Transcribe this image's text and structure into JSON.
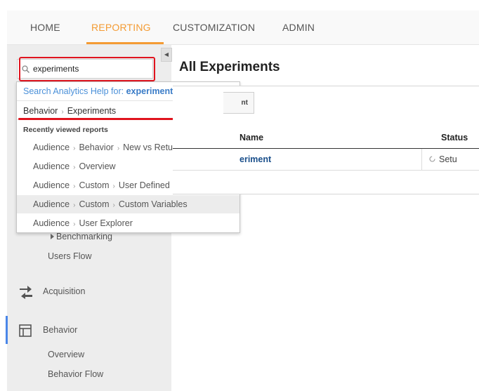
{
  "topnav": {
    "tabs": [
      {
        "label": "HOME"
      },
      {
        "label": "REPORTING"
      },
      {
        "label": "CUSTOMIZATION"
      },
      {
        "label": "ADMIN"
      }
    ],
    "active_color": "#f49b33"
  },
  "search": {
    "value": "experiments"
  },
  "dropdown": {
    "help_prefix": "Search Analytics Help for: ",
    "help_term": "experiments",
    "top_hit": [
      "Behavior",
      "Experiments"
    ],
    "recent_heading": "Recently viewed reports",
    "recent": [
      [
        "Audience",
        "Behavior",
        "New vs Returning"
      ],
      [
        "Audience",
        "Overview"
      ],
      [
        "Audience",
        "Custom",
        "User Defined"
      ],
      [
        "Audience",
        "Custom",
        "Custom Variables"
      ],
      [
        "Audience",
        "User Explorer"
      ]
    ]
  },
  "sidebar": {
    "benchmarking": "Benchmarking",
    "users_flow": "Users Flow",
    "acquisition": "Acquisition",
    "behavior": "Behavior",
    "overview": "Overview",
    "behavior_flow": "Behavior Flow"
  },
  "main": {
    "title": "All Experiments",
    "button_fragment": "nt",
    "table": {
      "headers": [
        "Name",
        "Status"
      ],
      "row": {
        "name_fragment": "eriment",
        "status_fragment": "Setu"
      }
    }
  }
}
